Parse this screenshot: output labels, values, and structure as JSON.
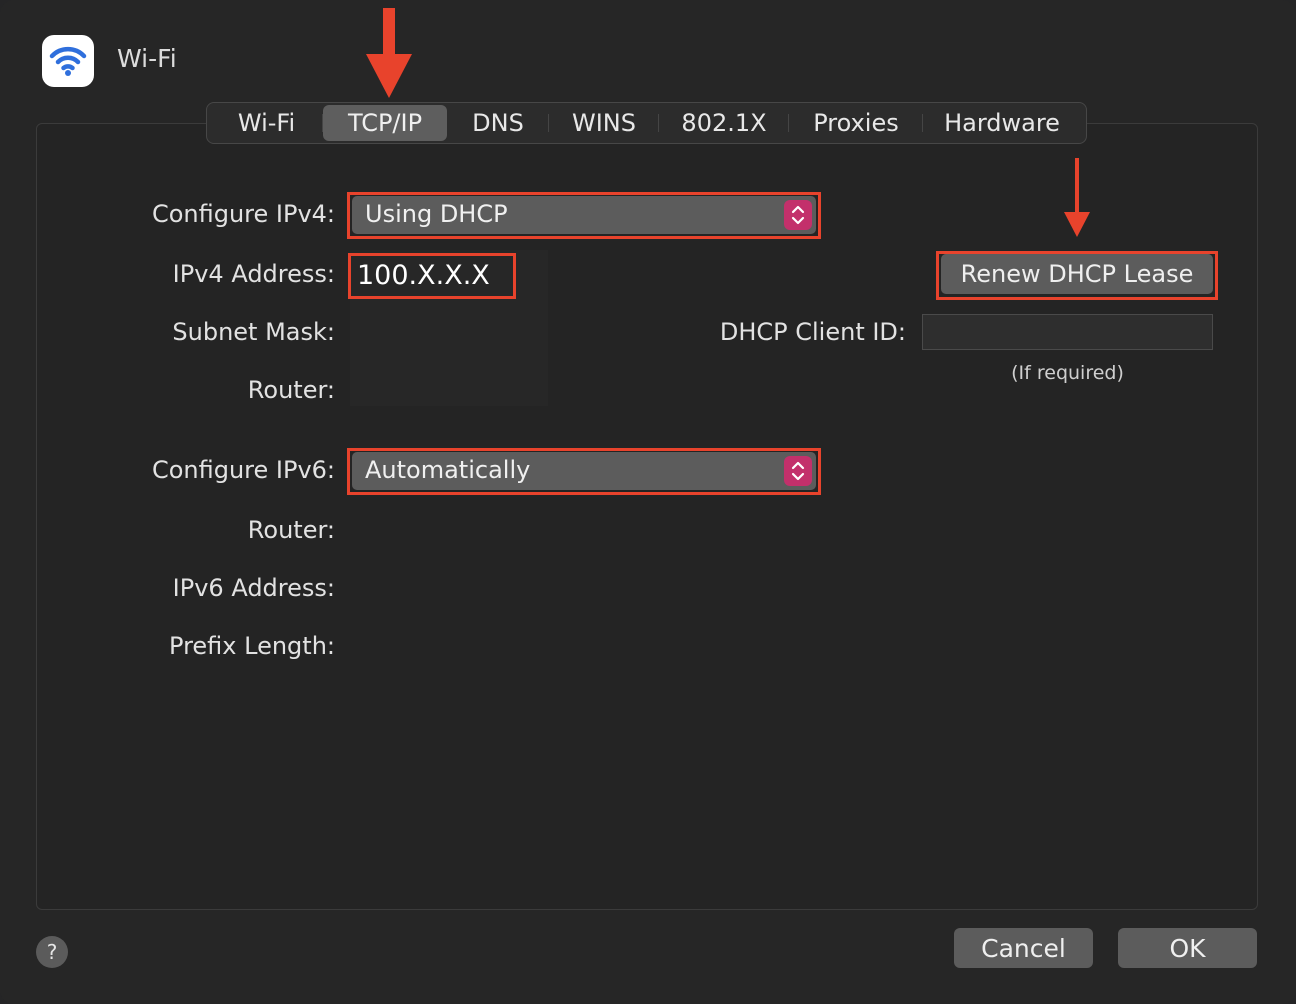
{
  "window": {
    "title": "Wi-Fi"
  },
  "tabs": [
    {
      "label": "Wi-Fi"
    },
    {
      "label": "TCP/IP",
      "active": true
    },
    {
      "label": "DNS"
    },
    {
      "label": "WINS"
    },
    {
      "label": "802.1X"
    },
    {
      "label": "Proxies"
    },
    {
      "label": "Hardware"
    }
  ],
  "ipv4": {
    "configure_label": "Configure IPv4:",
    "configure_value": "Using DHCP",
    "address_label": "IPv4 Address:",
    "address_value": "100.X.X.X",
    "subnet_label": "Subnet Mask:",
    "router_label": "Router:"
  },
  "dhcp": {
    "renew_label": "Renew DHCP Lease",
    "client_id_label": "DHCP Client ID:",
    "client_id_value": "",
    "client_id_hint": "(If required)"
  },
  "ipv6": {
    "configure_label": "Configure IPv6:",
    "configure_value": "Automatically",
    "router_label": "Router:",
    "address_label": "IPv6 Address:",
    "prefix_label": "Prefix Length:"
  },
  "footer": {
    "help_label": "?",
    "cancel_label": "Cancel",
    "ok_label": "OK"
  },
  "colors": {
    "annotation": "#e8432c",
    "stepper": "#c3306b",
    "wifi_icon": "#2f6fdc"
  },
  "icons": [
    "wifi-icon",
    "up-down-chevron-icon",
    "down-arrow-annotation-icon",
    "help-icon"
  ]
}
